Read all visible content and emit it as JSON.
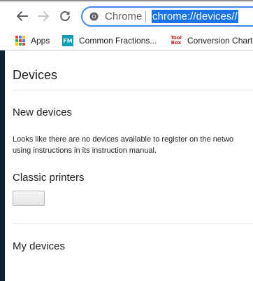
{
  "toolbar": {
    "site_label": "Chrome",
    "url": "chrome://devices//"
  },
  "bookmarks": [
    {
      "label": "Apps",
      "icon": "apps-grid-icon"
    },
    {
      "label": "Common Fractions...",
      "icon": "fm-icon"
    },
    {
      "label": "Conversion Chart",
      "icon": "toolbox-icon"
    }
  ],
  "bookmark_icon_text": {
    "fm": "FM",
    "toolbox_top": "Tool",
    "toolbox_bottom": "Box"
  },
  "page": {
    "title": "Devices",
    "new_devices": {
      "heading": "New devices",
      "message_line1": "Looks like there are no devices available to register on the netwo",
      "message_line2": "using instructions in its instruction manual."
    },
    "classic_printers": {
      "heading": "Classic printers"
    },
    "my_devices": {
      "heading": "My devices"
    }
  },
  "colors": {
    "accent": "#4285f4",
    "selection": "#1a73e8"
  }
}
